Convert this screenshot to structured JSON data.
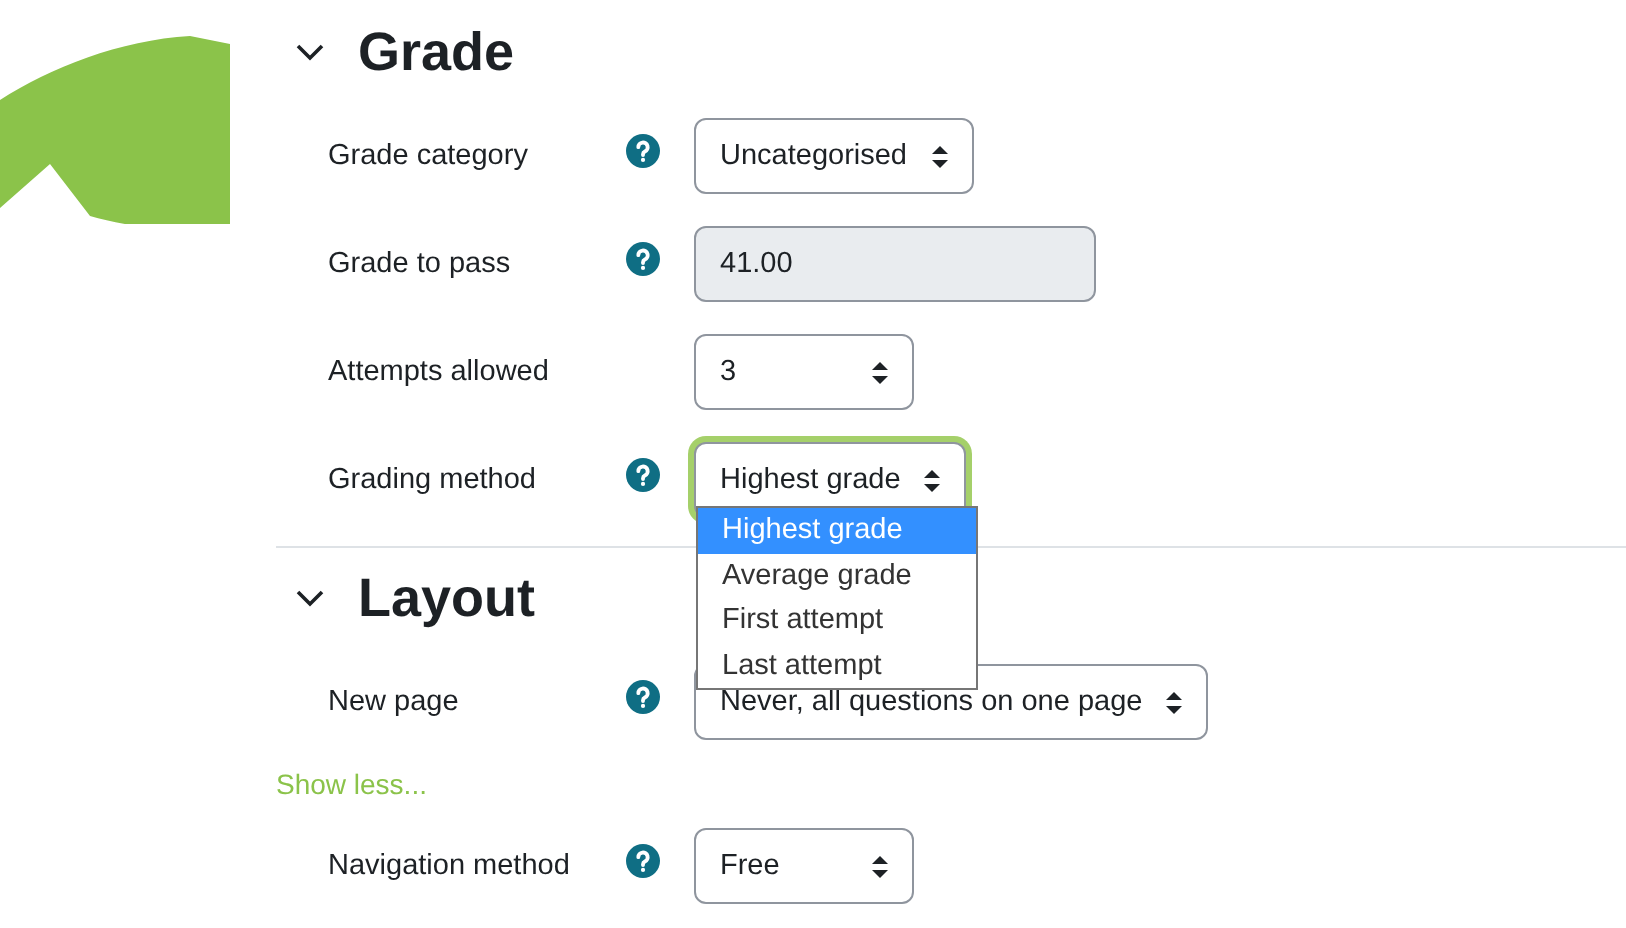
{
  "sections": [
    {
      "title": "Grade",
      "expanded": true,
      "fields": [
        {
          "kind": "select",
          "label": "Grade category",
          "help": true,
          "value": "Uncategorised"
        },
        {
          "kind": "text",
          "label": "Grade to pass",
          "help": true,
          "value": "41.00",
          "disabled": true
        },
        {
          "kind": "select",
          "label": "Attempts allowed",
          "help": false,
          "value": "3"
        },
        {
          "kind": "select",
          "label": "Grading method",
          "help": true,
          "value": "Highest grade",
          "focused": true,
          "open": true,
          "options": [
            {
              "label": "Highest grade",
              "selected": true
            },
            {
              "label": "Average grade",
              "selected": false
            },
            {
              "label": "First attempt",
              "selected": false
            },
            {
              "label": "Last attempt",
              "selected": false
            }
          ]
        }
      ]
    },
    {
      "title": "Layout",
      "expanded": true,
      "fields": [
        {
          "kind": "select",
          "label": "New page",
          "help": true,
          "value": "Never, all questions on one page"
        },
        {
          "kind": "link",
          "label": "Show less..."
        },
        {
          "kind": "select",
          "label": "Navigation method",
          "help": true,
          "value": "Free"
        }
      ]
    }
  ]
}
